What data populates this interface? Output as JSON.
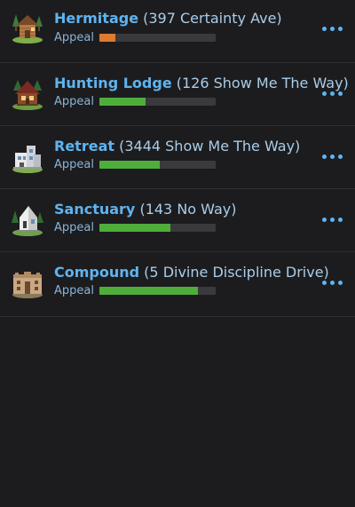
{
  "colors": {
    "background": "#1c1c1e",
    "name": "#5fb3f0",
    "address": "#a9cdea",
    "appeal_label": "#8ab4d8",
    "bar_track": "#3a3a3d",
    "bar_low": "#e07b2e",
    "bar_good": "#4fae3a",
    "more_dots": "#5fb3f0"
  },
  "buildings": [
    {
      "name": "Hermitage",
      "address": " (397 Certainty Ave)",
      "appeal_label": "Appeal",
      "appeal": 0.14,
      "appeal_color": "#e07b2e",
      "icon": "hermitage-cabin-icon"
    },
    {
      "name": "Hunting Lodge",
      "address": " (126 Show Me The Way)",
      "appeal_label": "Appeal",
      "appeal": 0.4,
      "appeal_color": "#4fae3a",
      "icon": "hunting-lodge-icon"
    },
    {
      "name": "Retreat",
      "address": " (3444 Show Me The Way)",
      "appeal_label": "Appeal",
      "appeal": 0.52,
      "appeal_color": "#4fae3a",
      "icon": "retreat-building-icon"
    },
    {
      "name": "Sanctuary",
      "address": " (143 No Way)",
      "appeal_label": "Appeal",
      "appeal": 0.61,
      "appeal_color": "#4fae3a",
      "icon": "sanctuary-building-icon"
    },
    {
      "name": "Compound",
      "address": " (5 Divine Discipline Drive)",
      "appeal_label": "Appeal",
      "appeal": 0.85,
      "appeal_color": "#4fae3a",
      "icon": "compound-building-icon"
    }
  ],
  "more_icon": "more-options-icon"
}
